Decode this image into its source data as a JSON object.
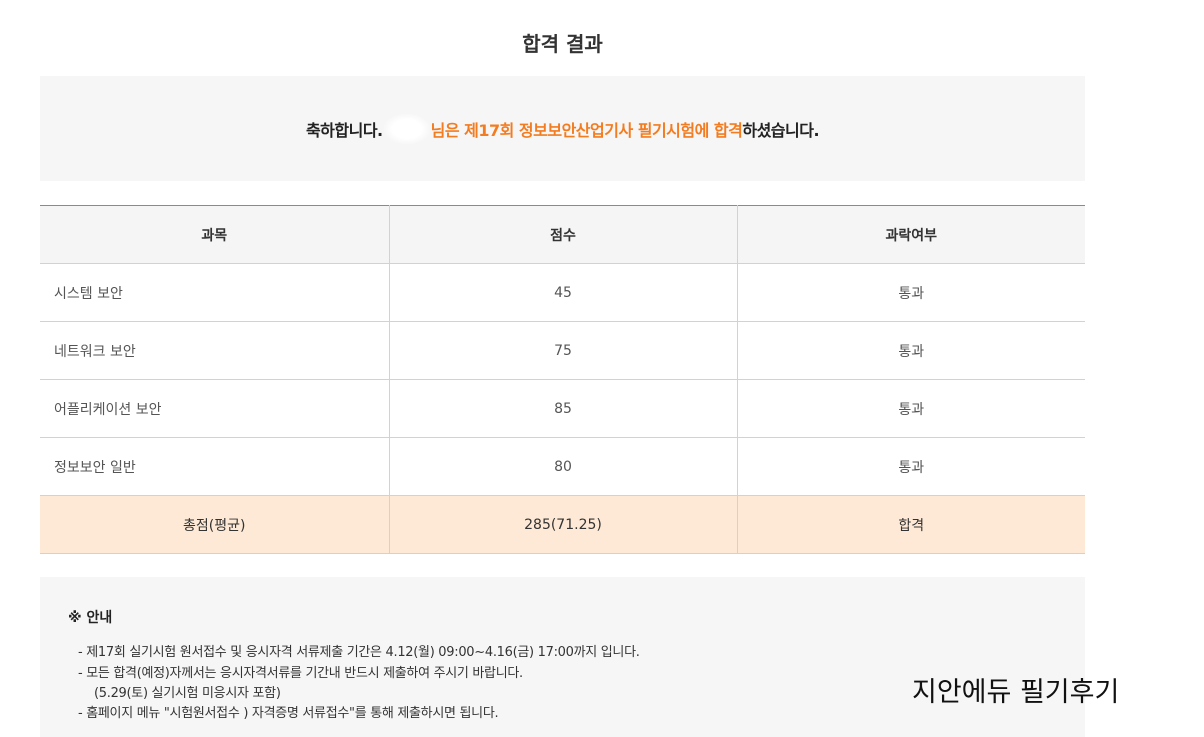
{
  "page": {
    "title": "합격 결과"
  },
  "congrats": {
    "prefix": "축하합니다. ",
    "highlight": "님은 제17회 정보보안산업기사 필기시험에 합격",
    "suffix": " 하셨습니다."
  },
  "table": {
    "headers": [
      "과목",
      "점수",
      "과락여부"
    ],
    "rows": [
      {
        "subject": "시스템 보안",
        "score": "45",
        "result": "통과"
      },
      {
        "subject": "네트워크 보안",
        "score": "75",
        "result": "통과"
      },
      {
        "subject": "어플리케이션 보안",
        "score": "85",
        "result": "통과"
      },
      {
        "subject": "정보보안 일반",
        "score": "80",
        "result": "통과"
      }
    ],
    "total": {
      "label": "총점(평균)",
      "score": "285(71.25)",
      "result": "합격"
    }
  },
  "notice": {
    "title": "※ 안내",
    "lines": [
      "- 제17회 실기시험 원서접수 및 응시자격 서류제출 기간은 4.12(월) 09:00~4.16(금) 17:00까지 입니다.",
      "- 모든 합격(예정)자께서는 응시자격서류를 기간내 반드시 제출하여 주시기 바랍니다.",
      "(5.29(토) 실기시험 미응시자 포함)",
      "- 홈페이지 메뉴 \"시험원서접수 ) 자격증명 서류접수\"를 통해 제출하시면 됩니다."
    ]
  },
  "watermark": "지안에듀 필기후기",
  "colors": {
    "accent": "#f47c20",
    "total_row_bg": "#fde9d5",
    "panel_bg": "#f6f6f6"
  }
}
